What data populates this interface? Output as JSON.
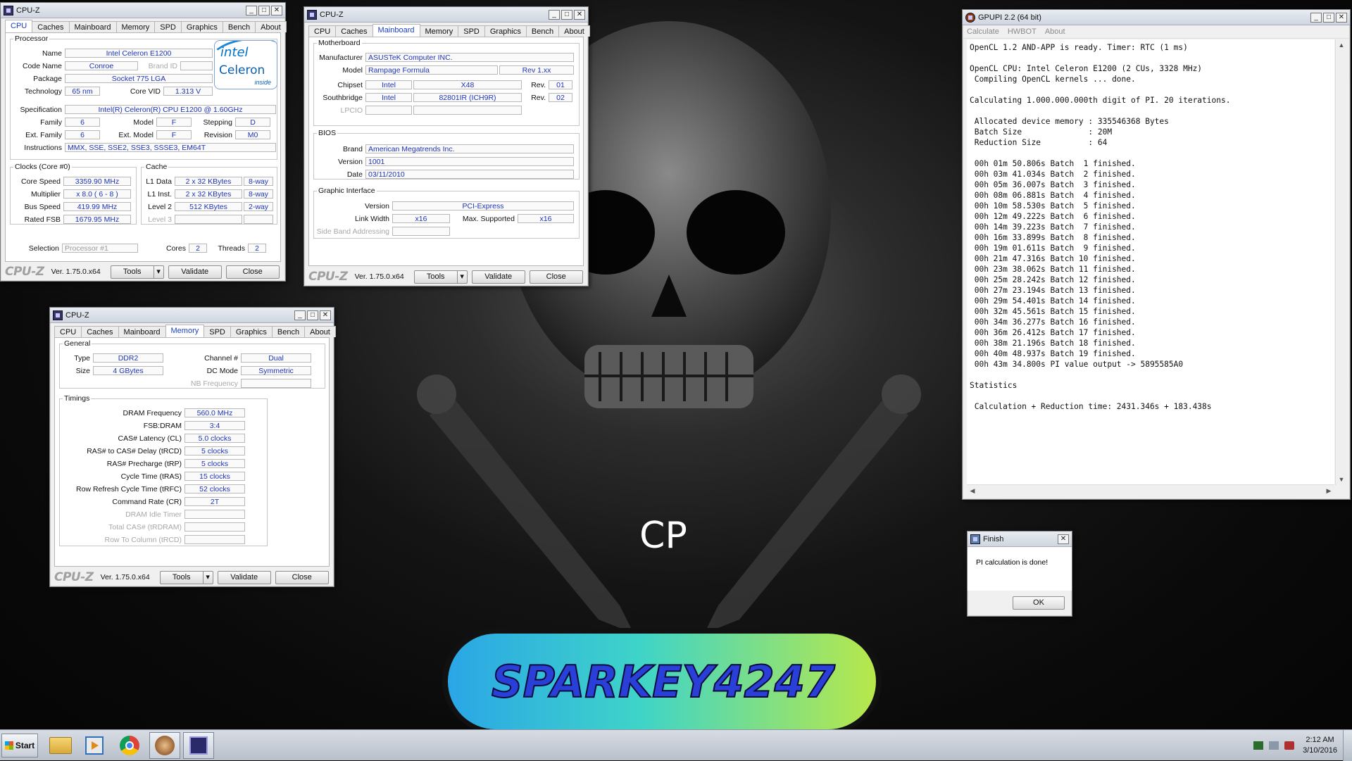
{
  "desktop": {
    "caption": "CP",
    "banner_text": "SPARKEY4247"
  },
  "cpuz_common": {
    "brand": "CPU-Z",
    "version": "Ver. 1.75.0.x64",
    "tools": "Tools",
    "validate": "Validate",
    "close": "Close",
    "title": "CPU-Z",
    "tabs": [
      "CPU",
      "Caches",
      "Mainboard",
      "Memory",
      "SPD",
      "Graphics",
      "Bench",
      "About"
    ]
  },
  "cpu": {
    "processor_legend": "Processor",
    "name_label": "Name",
    "name": "Intel Celeron E1200",
    "codename_label": "Code Name",
    "codename": "Conroe",
    "brandid_label": "Brand ID",
    "brandid": "",
    "package_label": "Package",
    "package": "Socket 775 LGA",
    "technology_label": "Technology",
    "technology": "65 nm",
    "corevid_label": "Core VID",
    "corevid": "1.313 V",
    "spec_label": "Specification",
    "spec": "Intel(R) Celeron(R) CPU      E1200  @ 1.60GHz",
    "family_label": "Family",
    "family": "6",
    "model_label": "Model",
    "model": "F",
    "stepping_label": "Stepping",
    "stepping": "D",
    "extfamily_label": "Ext. Family",
    "extfamily": "6",
    "extmodel_label": "Ext. Model",
    "extmodel": "F",
    "revision_label": "Revision",
    "revision": "M0",
    "instructions_label": "Instructions",
    "instructions": "MMX, SSE, SSE2, SSE3, SSSE3, EM64T",
    "clocks_legend": "Clocks (Core #0)",
    "corespeed_label": "Core Speed",
    "corespeed": "3359.90 MHz",
    "multiplier_label": "Multiplier",
    "multiplier": "x 8.0 ( 6 - 8 )",
    "busspeed_label": "Bus Speed",
    "busspeed": "419.99 MHz",
    "ratedfsb_label": "Rated FSB",
    "ratedfsb": "1679.95 MHz",
    "cache_legend": "Cache",
    "l1data_label": "L1 Data",
    "l1data": "2 x 32 KBytes",
    "l1data_way": "8-way",
    "l1inst_label": "L1 Inst.",
    "l1inst": "2 x 32 KBytes",
    "l1inst_way": "8-way",
    "level2_label": "Level 2",
    "level2": "512 KBytes",
    "level2_way": "2-way",
    "level3_label": "Level 3",
    "selection_label": "Selection",
    "selection": "Processor #1",
    "cores_label": "Cores",
    "cores": "2",
    "threads_label": "Threads",
    "threads": "2",
    "logo_brand": "intel",
    "logo_product": "Celeron",
    "logo_inside": "inside"
  },
  "mainboard": {
    "mb_legend": "Motherboard",
    "manufacturer_label": "Manufacturer",
    "manufacturer": "ASUSTeK Computer INC.",
    "model_label": "Model",
    "model": "Rampage Formula",
    "model_rev": "Rev 1.xx",
    "chipset_label": "Chipset",
    "chipset_vendor": "Intel",
    "chipset": "X48",
    "chipset_rev_label": "Rev.",
    "chipset_rev": "01",
    "south_label": "Southbridge",
    "south_vendor": "Intel",
    "south": "82801IR (ICH9R)",
    "south_rev_label": "Rev.",
    "south_rev": "02",
    "lpcio_label": "LPCIO",
    "bios_legend": "BIOS",
    "brand_label": "Brand",
    "brand": "American Megatrends Inc.",
    "version_label": "Version",
    "version": "1001",
    "date_label": "Date",
    "date": "03/11/2010",
    "gi_legend": "Graphic Interface",
    "giversion_label": "Version",
    "giversion": "PCI-Express",
    "linkwidth_label": "Link Width",
    "linkwidth": "x16",
    "maxsupported_label": "Max. Supported",
    "maxsupported": "x16",
    "sideband_label": "Side Band Addressing"
  },
  "memory": {
    "general_legend": "General",
    "type_label": "Type",
    "type": "DDR2",
    "channel_label": "Channel #",
    "channel": "Dual",
    "size_label": "Size",
    "size": "4 GBytes",
    "dcmode_label": "DC Mode",
    "dcmode": "Symmetric",
    "nbfreq_label": "NB Frequency",
    "timings_legend": "Timings",
    "timings": [
      {
        "label": "DRAM Frequency",
        "value": "560.0 MHz",
        "dim": false
      },
      {
        "label": "FSB:DRAM",
        "value": "3:4",
        "dim": false
      },
      {
        "label": "CAS# Latency (CL)",
        "value": "5.0 clocks",
        "dim": false
      },
      {
        "label": "RAS# to CAS# Delay (tRCD)",
        "value": "5 clocks",
        "dim": false
      },
      {
        "label": "RAS# Precharge (tRP)",
        "value": "5 clocks",
        "dim": false
      },
      {
        "label": "Cycle Time (tRAS)",
        "value": "15 clocks",
        "dim": false
      },
      {
        "label": "Row Refresh Cycle Time (tRFC)",
        "value": "52 clocks",
        "dim": false
      },
      {
        "label": "Command Rate (CR)",
        "value": "2T",
        "dim": false
      },
      {
        "label": "DRAM Idle Timer",
        "value": "",
        "dim": true
      },
      {
        "label": "Total CAS# (tRDRAM)",
        "value": "",
        "dim": true
      },
      {
        "label": "Row To Column (tRCD)",
        "value": "",
        "dim": true
      }
    ]
  },
  "gpupi": {
    "title": "GPUPI 2.2 (64 bit)",
    "menu": [
      "Calculate",
      "HWBOT",
      "About"
    ],
    "lines": [
      "OpenCL 1.2 AND-APP is ready. Timer: RTC (1 ms)",
      "",
      "OpenCL CPU: Intel Celeron E1200 (2 CUs, 3328 MHz)",
      " Compiling OpenCL kernels ... done.",
      "",
      "Calculating 1.000.000.000th digit of PI. 20 iterations.",
      "",
      " Allocated device memory : 335546368 Bytes",
      " Batch Size              : 20M",
      " Reduction Size          : 64",
      "",
      " 00h 01m 50.806s Batch  1 finished.",
      " 00h 03m 41.034s Batch  2 finished.",
      " 00h 05m 36.007s Batch  3 finished.",
      " 00h 08m 06.881s Batch  4 finished.",
      " 00h 10m 58.530s Batch  5 finished.",
      " 00h 12m 49.222s Batch  6 finished.",
      " 00h 14m 39.223s Batch  7 finished.",
      " 00h 16m 33.899s Batch  8 finished.",
      " 00h 19m 01.611s Batch  9 finished.",
      " 00h 21m 47.316s Batch 10 finished.",
      " 00h 23m 38.062s Batch 11 finished.",
      " 00h 25m 28.242s Batch 12 finished.",
      " 00h 27m 23.194s Batch 13 finished.",
      " 00h 29m 54.401s Batch 14 finished.",
      " 00h 32m 45.561s Batch 15 finished.",
      " 00h 34m 36.277s Batch 16 finished.",
      " 00h 36m 26.412s Batch 17 finished.",
      " 00h 38m 21.196s Batch 18 finished.",
      " 00h 40m 48.937s Batch 19 finished.",
      " 00h 43m 34.800s PI value output -> 5895585A0",
      "",
      "Statistics",
      "",
      " Calculation + Reduction time: 2431.346s + 183.438s"
    ]
  },
  "finish": {
    "title": "Finish",
    "message": "PI calculation is done!",
    "ok": "OK"
  },
  "taskbar": {
    "start": "Start",
    "time": "2:12 AM",
    "date": "3/10/2016"
  }
}
